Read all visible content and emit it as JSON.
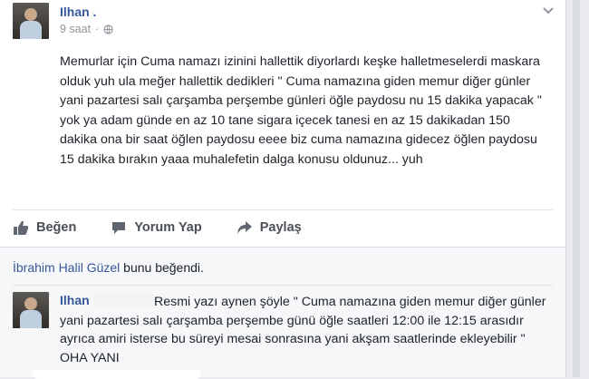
{
  "post": {
    "author": "Ilhan .",
    "time": "9 saat",
    "text": "Memurlar için Cuma namazı izinini hallettik diyorlardı keşke halletmeselerdi maskara olduk yuh ula meğer hallettik dedikleri \" Cuma namazına giden memur diğer günler yani pazartesi salı çarşamba perşembe günleri öğle paydosu nu 15 dakika yapacak \" yok ya adam günde en az 10 tane sigara içecek tanesi en az 15 dakikadan 150 dakika ona bir saat öğlen paydosu eeee biz cuma namazına gidecez öğlen paydosu 15 dakika bırakın yaaa muhalefetin dalga konusu oldunuz... yuh"
  },
  "actions": {
    "like": "Beğen",
    "comment": "Yorum Yap",
    "share": "Paylaş"
  },
  "likes": {
    "liker": "İbrahim Halil Güzel",
    "suffix": " bunu beğendi."
  },
  "comment": {
    "author": "Ilhan",
    "text": "Resmi yazı aynen şöyle \" Cuma namazına giden memur diğer günler yani pazartesi salı çarşamba perşembe günü öğle saatleri 12:00 ile 12:15 arasıdır ayrıca amiri isterse bu süreyi mesai sonrasına yani akşam saatlerinde ekleyebilir \" OHA YANI"
  },
  "colors": {
    "link": "#365899",
    "text": "#1d2129",
    "muted": "#90949c"
  },
  "icons": [
    "chevron-down-icon",
    "globe-icon",
    "thumbs-up-icon",
    "comment-icon",
    "share-icon"
  ]
}
